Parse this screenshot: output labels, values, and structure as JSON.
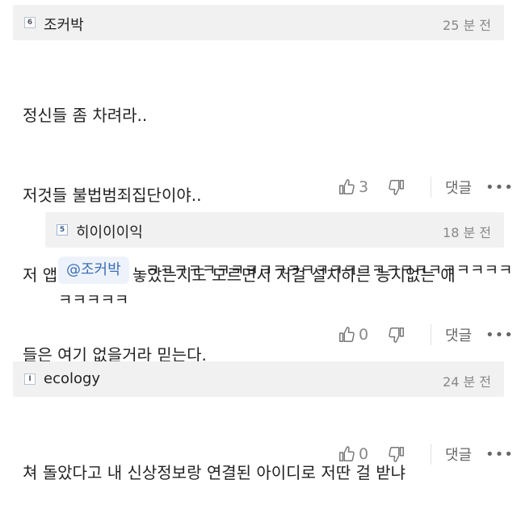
{
  "comments": [
    {
      "level": "6",
      "author": "조커박",
      "time": "25 분 전",
      "lines": [
        "정신들 좀 차려라..",
        "저것들 불법범죄집단이야..",
        "저 앱에 뭘 심어 놓았는지도 모르면서 저걸 설치하는 능지없는 애",
        "들은 여기 없을거라 믿는다."
      ],
      "likes": "3",
      "reply_label": "댓글",
      "more": "•••"
    },
    {
      "level": "5",
      "author": "히이이이익",
      "time": "18 분 전",
      "mention": "@조커박",
      "line1": "ㅋㅋㅋㅋㅋㅋㅋㅋㅋㅋㅋㅋㅋㅋㅋㅋㅋㅋㅋㅋㅋㅋㅋㅋㅋㅋ",
      "line2": "ㅋㅋㅋㅋㅋ",
      "likes": "0",
      "reply_label": "댓글",
      "more": "•••"
    },
    {
      "level": "I",
      "author": "ecology",
      "time": "24 분 전",
      "lines": [
        "쳐 돌았다고 내 신상정보랑 연결된 아이디로 저딴 걸 받냐"
      ],
      "likes": "0",
      "reply_label": "댓글",
      "more": "•••"
    }
  ]
}
